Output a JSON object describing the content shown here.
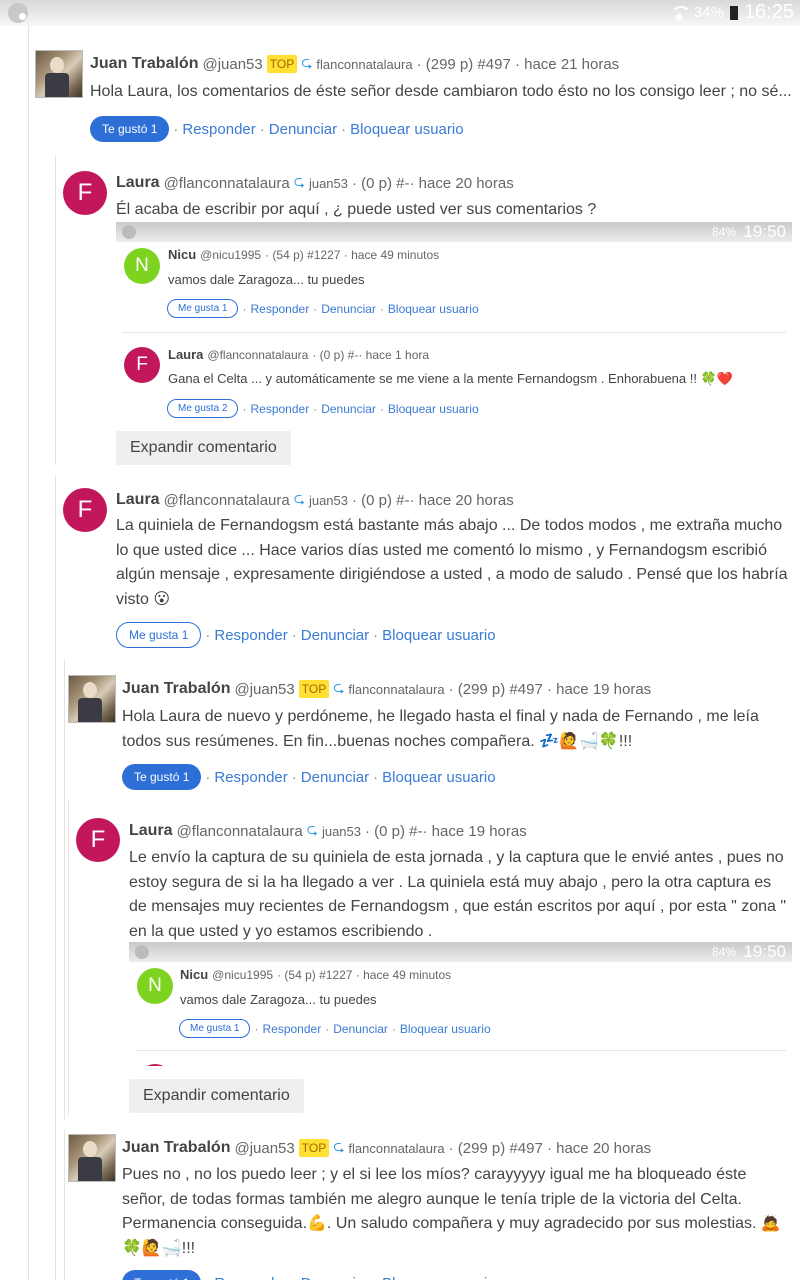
{
  "status_bar": {
    "battery": "34%",
    "time": "16:25"
  },
  "embedded_status": {
    "battery": "84%",
    "time": "19:50"
  },
  "tags": {
    "top": "TOP"
  },
  "actions": {
    "reply": "Responder",
    "report": "Denunciar",
    "block": "Bloquear usuario",
    "expand": "Expandir comentario"
  },
  "comments": [
    {
      "author": "Juan Trabalón",
      "handle": "@juan53",
      "reply_to": "flanconnatalaura",
      "stats": "· (299 p) #497 · hace 21 horas",
      "text": "Hola Laura, los comentarios de éste señor desde cambiaron todo ésto no los consigo leer ; no sé...",
      "like_label": "Te gustó 1"
    },
    {
      "author": "Laura",
      "avatar": "F",
      "handle": "@flanconnatalaura",
      "reply_to": "juan53",
      "stats": "· (0 p) #-· hace 20 horas",
      "text": "Él acaba de escribir por aquí , ¿ puede usted ver sus comentarios ?"
    },
    {
      "author": "Laura",
      "avatar": "F",
      "handle": "@flanconnatalaura",
      "reply_to": "juan53",
      "stats": "· (0 p) #-· hace 20 horas",
      "text": "La quiniela de Fernandogsm está bastante más abajo ... De todos modos , me extraña mucho lo que usted dice ... Hace varios días usted me comentó lo mismo , y Fernandogsm escribió algún mensaje , expresamente dirigiéndose a usted , a modo de saludo . Pensé que los habría visto 😮",
      "like_label": "Me gusta 1"
    },
    {
      "author": "Juan Trabalón",
      "handle": "@juan53",
      "reply_to": "flanconnatalaura",
      "stats": "· (299 p) #497 · hace 19 horas",
      "text": "Hola Laura de nuevo y perdóneme, he llegado hasta el final y nada de Fernando , me leía todos sus resúmenes. En fin...buenas noches compañera. 💤🙋🛁🍀!!!",
      "like_label": "Te gustó 1"
    },
    {
      "author": "Laura",
      "avatar": "F",
      "handle": "@flanconnatalaura",
      "reply_to": "juan53",
      "stats": "· (0 p) #-· hace 19 horas",
      "text": "Le envío la captura de su quiniela de esta jornada , y la captura que le envié antes , pues no estoy segura de si la ha llegado a ver . La quiniela está muy abajo , pero la otra captura es de mensajes muy recientes de Fernandogsm , que están escritos por aquí , por esta \" zona \" en la que usted y yo estamos escribiendo ."
    },
    {
      "author": "Juan Trabalón",
      "handle": "@juan53",
      "reply_to": "flanconnatalaura",
      "stats": "· (299 p) #497 · hace 20 horas",
      "text": "Pues no , no los puedo leer ; y el si lee los míos? carayyyyy igual me ha bloqueado éste señor, de todas formas también me alegro aunque le tenía triple de la victoria del Celta. Permanencia conseguida.💪. Un saludo compañera y muy agradecido por sus molestias. 🙇🍀🙋🛁!!!"
    }
  ],
  "embedded": [
    {
      "author": "Nicu",
      "avatar": "N",
      "handle": "@nicu1995",
      "stats": "· (54 p) #1227 · hace 49 minutos",
      "text": "vamos dale Zaragoza... tu puedes",
      "like_label": "Me gusta 1"
    },
    {
      "author": "Laura",
      "avatar": "F",
      "handle": "@flanconnatalaura",
      "stats": "· (0 p) #-· hace 1 hora",
      "text": "Gana el Celta ... y automáticamente se me viene a la mente Fernandogsm . Enhorabuena !! 🍀❤️",
      "like_label": "Me gusta 2"
    }
  ]
}
